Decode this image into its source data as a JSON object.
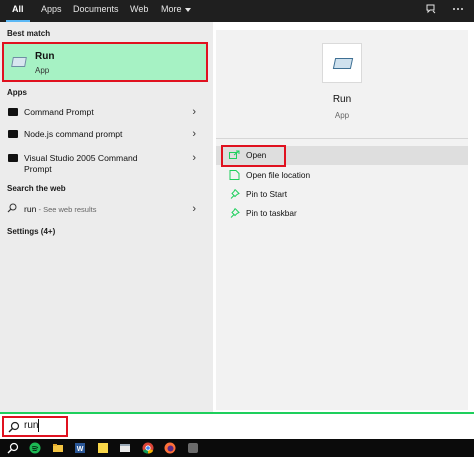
{
  "topbar": {
    "tabs": [
      {
        "label": "All",
        "active": true
      },
      {
        "label": "Apps",
        "active": false
      },
      {
        "label": "Documents",
        "active": false
      },
      {
        "label": "Web",
        "active": false
      },
      {
        "label": "More",
        "active": false
      }
    ],
    "icons": [
      "feedback-icon",
      "more-options-icon"
    ]
  },
  "left": {
    "best_match_label": "Best match",
    "best_match": {
      "title": "Run",
      "subtitle": "App",
      "icon": "run-app-icon"
    },
    "apps_label": "Apps",
    "apps": [
      {
        "label": "Command Prompt"
      },
      {
        "label": "Node.js command prompt"
      },
      {
        "label_line1": "Visual Studio 2005 Command",
        "label_line2": "Prompt"
      }
    ],
    "web_label": "Search the web",
    "web_item": {
      "query": "run",
      "hint": " - See web results"
    },
    "settings_label": "Settings (4+)"
  },
  "right": {
    "title": "Run",
    "subtitle": "App",
    "actions": [
      {
        "label": "Open",
        "icon": "open-icon",
        "highlighted": true
      },
      {
        "label": "Open file location",
        "icon": "file-location-icon"
      },
      {
        "label": "Pin to Start",
        "icon": "pin-icon"
      },
      {
        "label": "Pin to taskbar",
        "icon": "pin-icon"
      }
    ]
  },
  "search": {
    "value": "run",
    "icon": "search-icon"
  },
  "taskbar": {
    "icons": [
      "search-icon",
      "spotify-icon",
      "file-explorer-icon",
      "word-icon",
      "sticky-notes-icon",
      "file-manager-icon",
      "chrome-icon",
      "firefox-icon",
      "app-icon"
    ]
  },
  "colors": {
    "accent_green": "#1ecf5c",
    "highlight_red": "#e0111f",
    "best_match_bg": "#a6f2c4"
  }
}
